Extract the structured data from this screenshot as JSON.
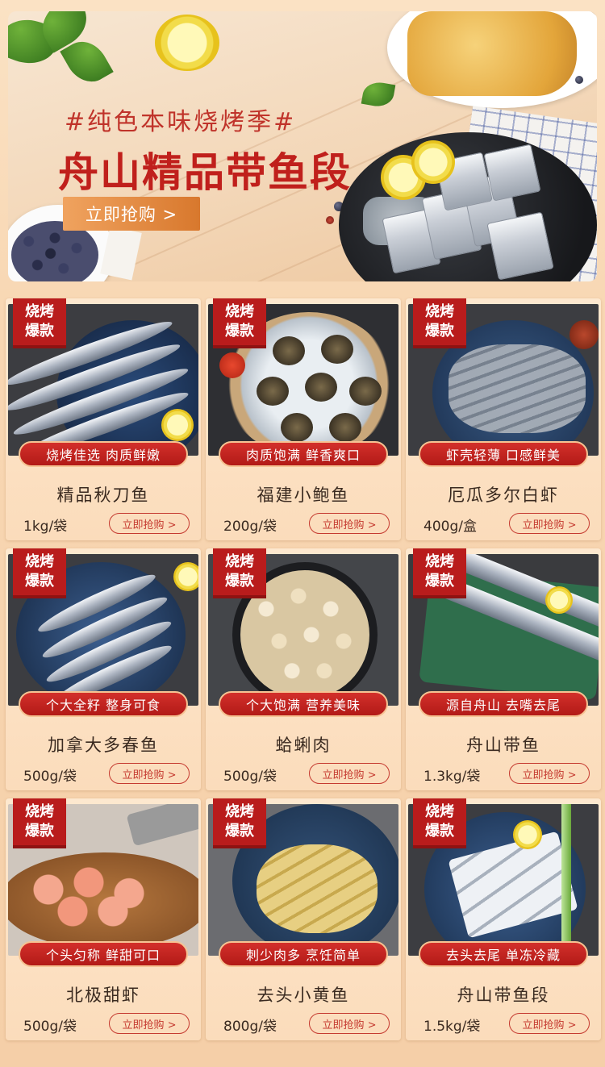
{
  "banner": {
    "subtitle": "#纯色本味烧烤季#",
    "title": "舟山精品带鱼段",
    "button_label": "立即抢购 >"
  },
  "badge": {
    "line1": "烧烤",
    "line2": "爆款"
  },
  "products": [
    {
      "tagline": "烧烤佳选 肉质鲜嫩",
      "name": "精品秋刀鱼",
      "weight": "1kg/袋",
      "buy_label": "立即抢购 >"
    },
    {
      "tagline": "肉质饱满 鲜香爽口",
      "name": "福建小鲍鱼",
      "weight": "200g/袋",
      "buy_label": "立即抢购 >"
    },
    {
      "tagline": "虾壳轻薄 口感鲜美",
      "name": "厄瓜多尔白虾",
      "weight": "400g/盒",
      "buy_label": "立即抢购 >"
    },
    {
      "tagline": "个大全籽 整身可食",
      "name": "加拿大多春鱼",
      "weight": "500g/袋",
      "buy_label": "立即抢购 >"
    },
    {
      "tagline": "个大饱满 营养美味",
      "name": "蛤蜊肉",
      "weight": "500g/袋",
      "buy_label": "立即抢购 >"
    },
    {
      "tagline": "源自舟山 去嘴去尾",
      "name": "舟山带鱼",
      "weight": "1.3kg/袋",
      "buy_label": "立即抢购 >"
    },
    {
      "tagline": "个头匀称 鲜甜可口",
      "name": "北极甜虾",
      "weight": "500g/袋",
      "buy_label": "立即抢购 >"
    },
    {
      "tagline": "刺少肉多 烹饪简单",
      "name": "去头小黄鱼",
      "weight": "800g/袋",
      "buy_label": "立即抢购 >"
    },
    {
      "tagline": "去头去尾 单冻冷藏",
      "name": "舟山带鱼段",
      "weight": "1.5kg/袋",
      "buy_label": "立即抢购 >"
    }
  ],
  "colors": {
    "accent_red": "#b91c1c",
    "banner_button": "#e08a3e",
    "background": "#f8d7b3"
  }
}
